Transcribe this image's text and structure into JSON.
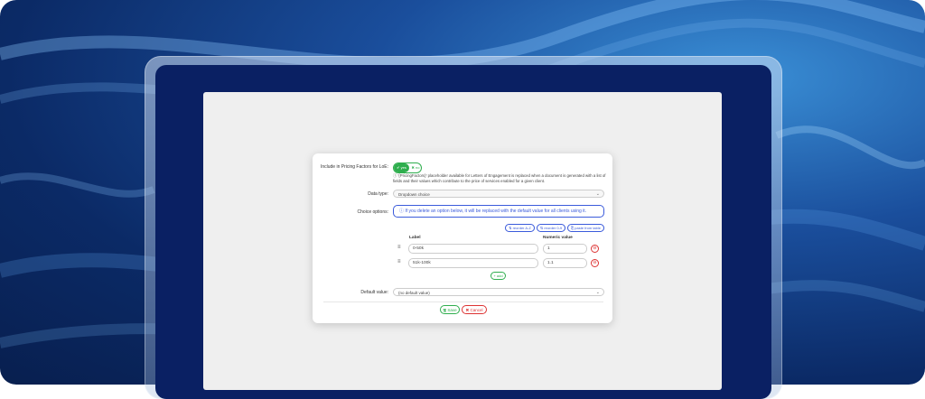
{
  "form": {
    "include_label": "Include in Pricing Factors for LoE:",
    "toggle_yes": "✔ yes",
    "toggle_no": "✖ no",
    "help_text": "ⓘ '{PricingFactors}' placeholder available for Letters of Engagement is replaced when a document is generated with a list of fields and their values which contribute to the price of services enabled for a given client.",
    "data_type_label": "Data type:",
    "data_type_value": "Dropdown choice",
    "choice_options_label": "Choice options:",
    "alert_text": "ⓘ If you delete an option below, it will be replaced with the default value for all clients using it.",
    "reorder_az": "⇅ reorder A-Z",
    "reorder_09": "⇅ reorder 0-9",
    "paste_table": "⎘ paste from table",
    "col_label": "Label",
    "col_numeric": "Numeric value",
    "options": [
      {
        "label": "0-50k",
        "numeric": "1"
      },
      {
        "label": "51k-100k",
        "numeric": "1.1"
      }
    ],
    "add_label": "+ add",
    "default_value_label": "Default value:",
    "default_value": "(no default value)",
    "save_label": "🖫 Save",
    "cancel_label": "✖ Cancel"
  },
  "colors": {
    "accent_green": "#2fae4e",
    "accent_blue": "#3b5bdb",
    "danger": "#dd3333",
    "bezel": "#0a2063"
  }
}
